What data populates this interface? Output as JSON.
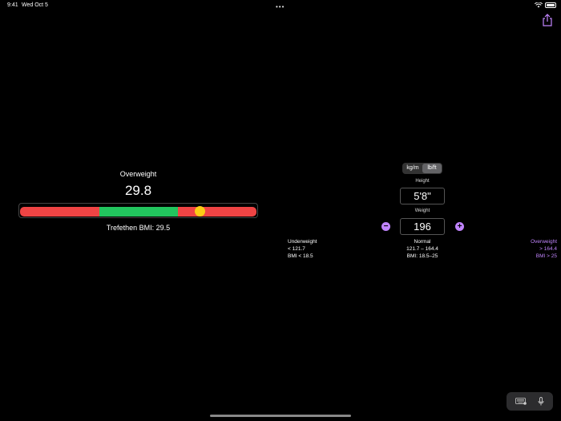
{
  "status_bar": {
    "time": "9:41",
    "date": "Wed Oct 5",
    "wifi_icon": "wifi-icon",
    "battery_icon": "battery-icon"
  },
  "toolbar": {
    "share_icon": "share-icon"
  },
  "bmi": {
    "category": "Overweight",
    "value": "29.8",
    "trefethen": "Trefethen BMI: 29.5",
    "scale_position": 0.76,
    "colors": {
      "under": "#ef4444",
      "normal": "#22c55e",
      "over": "#ef4444",
      "marker": "#facc15"
    }
  },
  "units": {
    "options": [
      "kg/m",
      "lb/ft"
    ],
    "selected": "lb/ft"
  },
  "height": {
    "label": "Height",
    "value": "5'8\""
  },
  "weight": {
    "label": "Weight",
    "value": "196",
    "decrement": "−",
    "increment": "+"
  },
  "ranges": {
    "underweight": {
      "title": "Underweight",
      "weight": "< 121.7",
      "bmi": "BMI < 18.5"
    },
    "normal": {
      "title": "Normal",
      "weight": "121.7 – 164.4",
      "bmi": "BMI: 18.5–25"
    },
    "overweight": {
      "title": "Overweight",
      "weight": "> 164.4",
      "bmi": "BMI > 25"
    }
  },
  "accent_color": "#c084fc",
  "keyboard_bar": {
    "keyboard_icon": "keyboard-icon",
    "mic_icon": "microphone-icon"
  }
}
